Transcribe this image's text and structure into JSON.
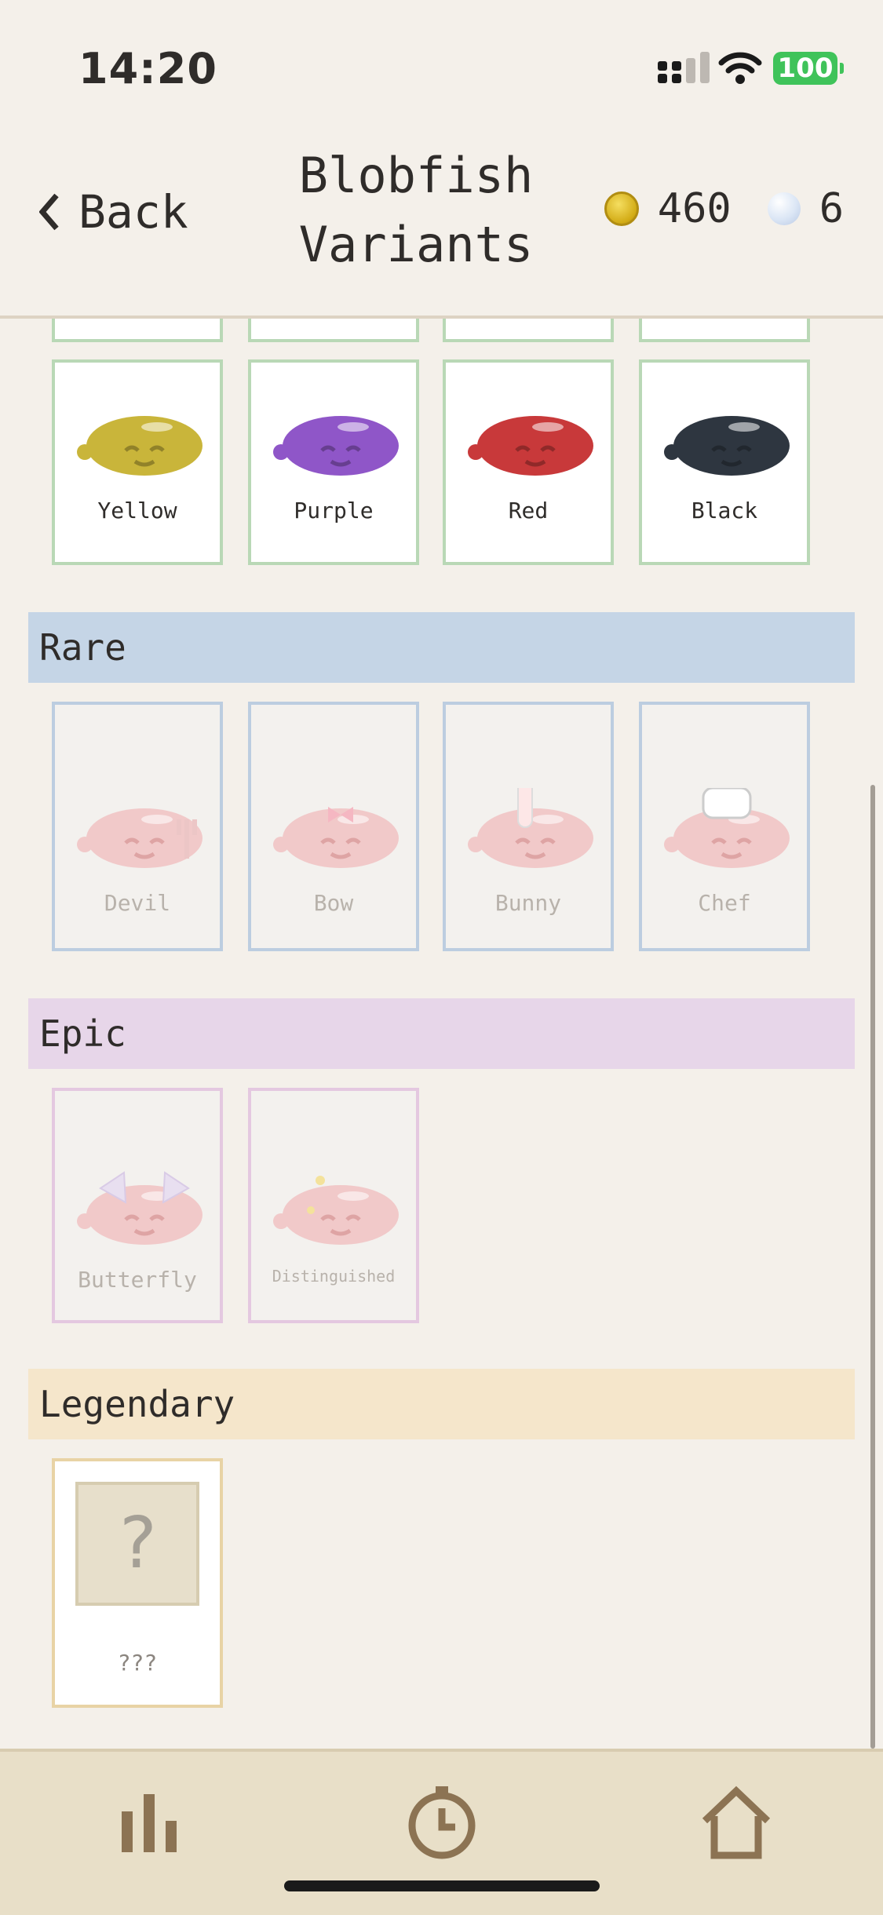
{
  "status": {
    "time": "14:20",
    "battery": "100"
  },
  "header": {
    "back_label": "Back",
    "title_line1": "Blobfish",
    "title_line2": "Variants",
    "coins": "460",
    "pearls": "6"
  },
  "common": {
    "items": [
      {
        "label": "Yellow",
        "color": "#c9b53a"
      },
      {
        "label": "Purple",
        "color": "#8f56c8"
      },
      {
        "label": "Red",
        "color": "#c8393a"
      },
      {
        "label": "Black",
        "color": "#2e3640"
      }
    ]
  },
  "rare": {
    "title": "Rare",
    "items": [
      {
        "label": "Devil"
      },
      {
        "label": "Bow"
      },
      {
        "label": "Bunny"
      },
      {
        "label": "Chef"
      }
    ]
  },
  "epic": {
    "title": "Epic",
    "items": [
      {
        "label": "Butterfly"
      },
      {
        "label": "Distinguished"
      }
    ]
  },
  "legendary": {
    "title": "Legendary",
    "items": [
      {
        "label": "???",
        "glyph": "?"
      }
    ]
  },
  "colors": {
    "rare_header": "#c5d5e6",
    "epic_header": "#e7d6e9",
    "legendary_header": "#f5e6cb",
    "rare_border": "#bccde0",
    "epic_border": "#e4c8e0",
    "legendary_border": "#e8d3a5",
    "common_border": "#b9d8b6",
    "locked_blob": "#f1c9c9"
  },
  "tabs": [
    {
      "icon": "stats-icon"
    },
    {
      "icon": "timer-icon"
    },
    {
      "icon": "home-icon"
    }
  ]
}
